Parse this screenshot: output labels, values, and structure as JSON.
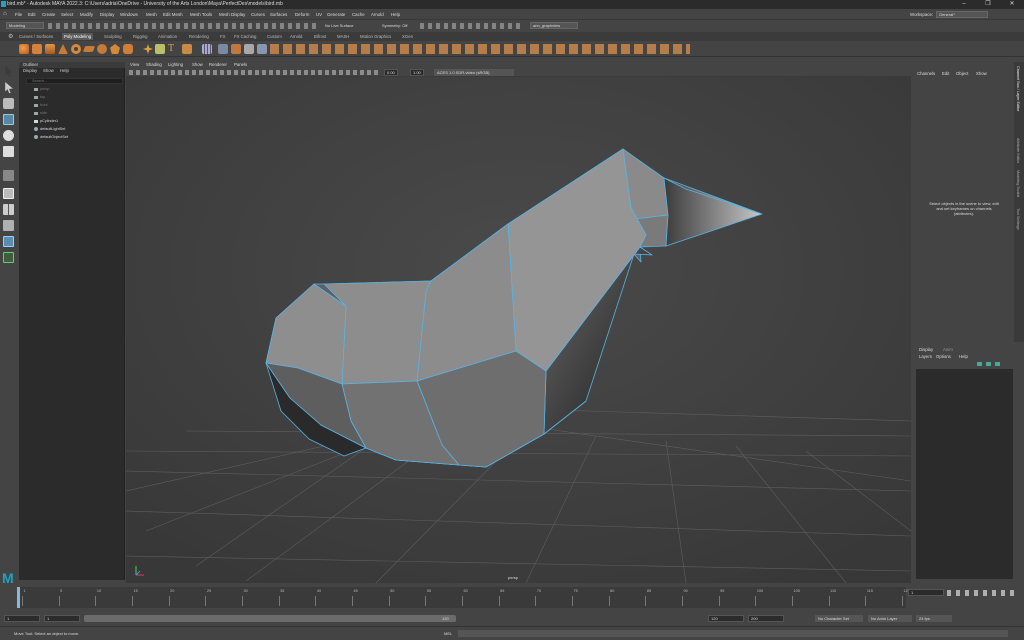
{
  "window": {
    "title": "bird.mb* - Autodesk MAYA 2022.3: C:\\Users\\adria\\OneDrive - University of the Arts London\\Maya\\PerfectDes\\models\\bird.mb",
    "controls": [
      "–",
      "❐",
      "✕"
    ]
  },
  "menu": {
    "items": [
      "File",
      "Edit",
      "Create",
      "Select",
      "Modify",
      "Display",
      "Windows",
      "Mesh",
      "Edit Mesh",
      "Mesh Tools",
      "Mesh Display",
      "Curves",
      "Surfaces",
      "Deform",
      "UV",
      "Generate",
      "Cache",
      "Arnold",
      "Help"
    ],
    "workspace_label": "Workspace:",
    "workspace_value": "General*"
  },
  "status_line": {
    "mode": "Modeling",
    "no_live_surface": "No Live Surface",
    "symmetry": "Symmetry: Off",
    "camera": "ann_graphview"
  },
  "shelf_tabs": [
    "Curves / Surfaces",
    "Poly Modeling",
    "Sculpting",
    "Rigging",
    "Animation",
    "Rendering",
    "FX",
    "FX Caching",
    "Custom",
    "Arnold",
    "Bifrost",
    "MASH",
    "Motion Graphics",
    "XGen"
  ],
  "shelf_active_tab": "Poly Modeling",
  "viewport": {
    "menu": [
      "View",
      "Shading",
      "Lighting",
      "Show",
      "Renderer",
      "Panels"
    ],
    "exposure": "0.00",
    "gamma": "1.00",
    "colorspace": "ACES 1.0 SDR-video (sRGB)",
    "camera_label": "persp"
  },
  "outliner": {
    "title": "Outliner",
    "menu": [
      "Display",
      "Show",
      "Help"
    ],
    "search_placeholder": "Search...",
    "items": [
      "persp",
      "top",
      "front",
      "side",
      "pCylinder1",
      "defaultLightSet",
      "defaultObjectSet"
    ]
  },
  "channel_box": {
    "menu": [
      "Channels",
      "Edit",
      "Object",
      "Show"
    ],
    "message": "Select objects in the scene to view, edit and set keyframes on channels (attributes)."
  },
  "layer_editor": {
    "tabs": [
      "Display",
      "Anim"
    ],
    "menu": [
      "Layers",
      "Options",
      "Help"
    ]
  },
  "side_tabs": [
    "Channel Box / Layer Editor",
    "Attribute Editor",
    "Modeling Toolkit",
    "Tool Settings"
  ],
  "time_slider": {
    "ticks": [
      "1",
      "5",
      "10",
      "15",
      "20",
      "25",
      "30",
      "35",
      "40",
      "45",
      "50",
      "55",
      "60",
      "65",
      "70",
      "75",
      "80",
      "85",
      "90",
      "95",
      "100",
      "105",
      "110",
      "115",
      "120"
    ],
    "current_frame": "1"
  },
  "range_slider": {
    "start": "1",
    "inner_start": "1",
    "inner_end": "120",
    "end": "120",
    "max": "200",
    "character_set": "No Character Set",
    "anim_layer": "No Anim Layer",
    "fps": "24 fps"
  },
  "command_line": {
    "mel": "MEL",
    "help": "Move Tool: Select an object to move."
  },
  "colors": {
    "selection_wire": "#56b4e6",
    "maya_logo": "#1ba3c4"
  }
}
